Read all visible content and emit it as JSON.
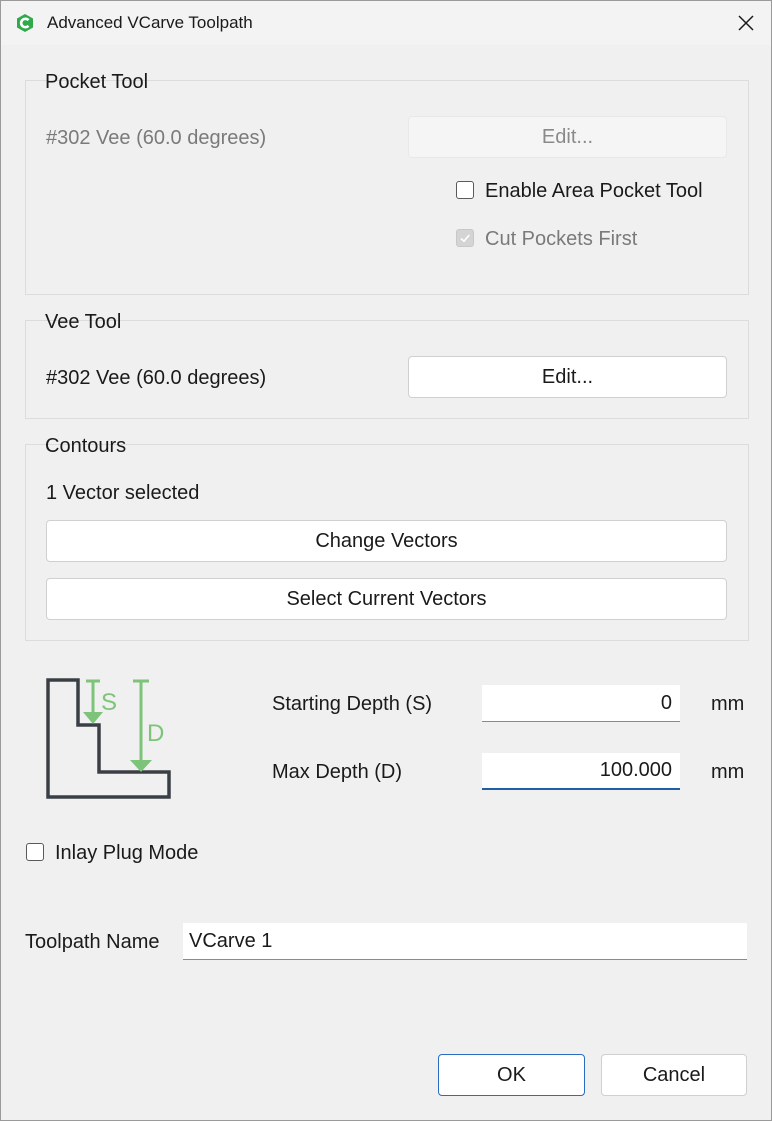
{
  "window": {
    "title": "Advanced VCarve Toolpath"
  },
  "pocket_tool": {
    "title": "Pocket Tool",
    "tool_name": "#302 Vee (60.0 degrees)",
    "edit_label": "Edit...",
    "enable_area_label": "Enable Area Pocket Tool",
    "cut_first_label": "Cut Pockets First"
  },
  "vee_tool": {
    "title": "Vee Tool",
    "tool_name": "#302 Vee (60.0 degrees)",
    "edit_label": "Edit..."
  },
  "contours": {
    "title": "Contours",
    "status": "1 Vector selected",
    "change_label": "Change Vectors",
    "select_label": "Select Current Vectors"
  },
  "depth": {
    "diagram_s": "S",
    "diagram_d": "D",
    "start_label": "Starting Depth (S)",
    "start_value": "0",
    "start_unit": "mm",
    "max_label": "Max Depth (D)",
    "max_value": "100.000",
    "max_unit": "mm"
  },
  "inlay": {
    "label": "Inlay Plug Mode"
  },
  "toolpath": {
    "label": "Toolpath Name",
    "value": "VCarve 1"
  },
  "footer": {
    "ok_label": "OK",
    "cancel_label": "Cancel"
  },
  "colors": {
    "accent": "#2a6cbf",
    "diagram_green": "#7dc47a",
    "app_icon": "#2eaa4a"
  }
}
